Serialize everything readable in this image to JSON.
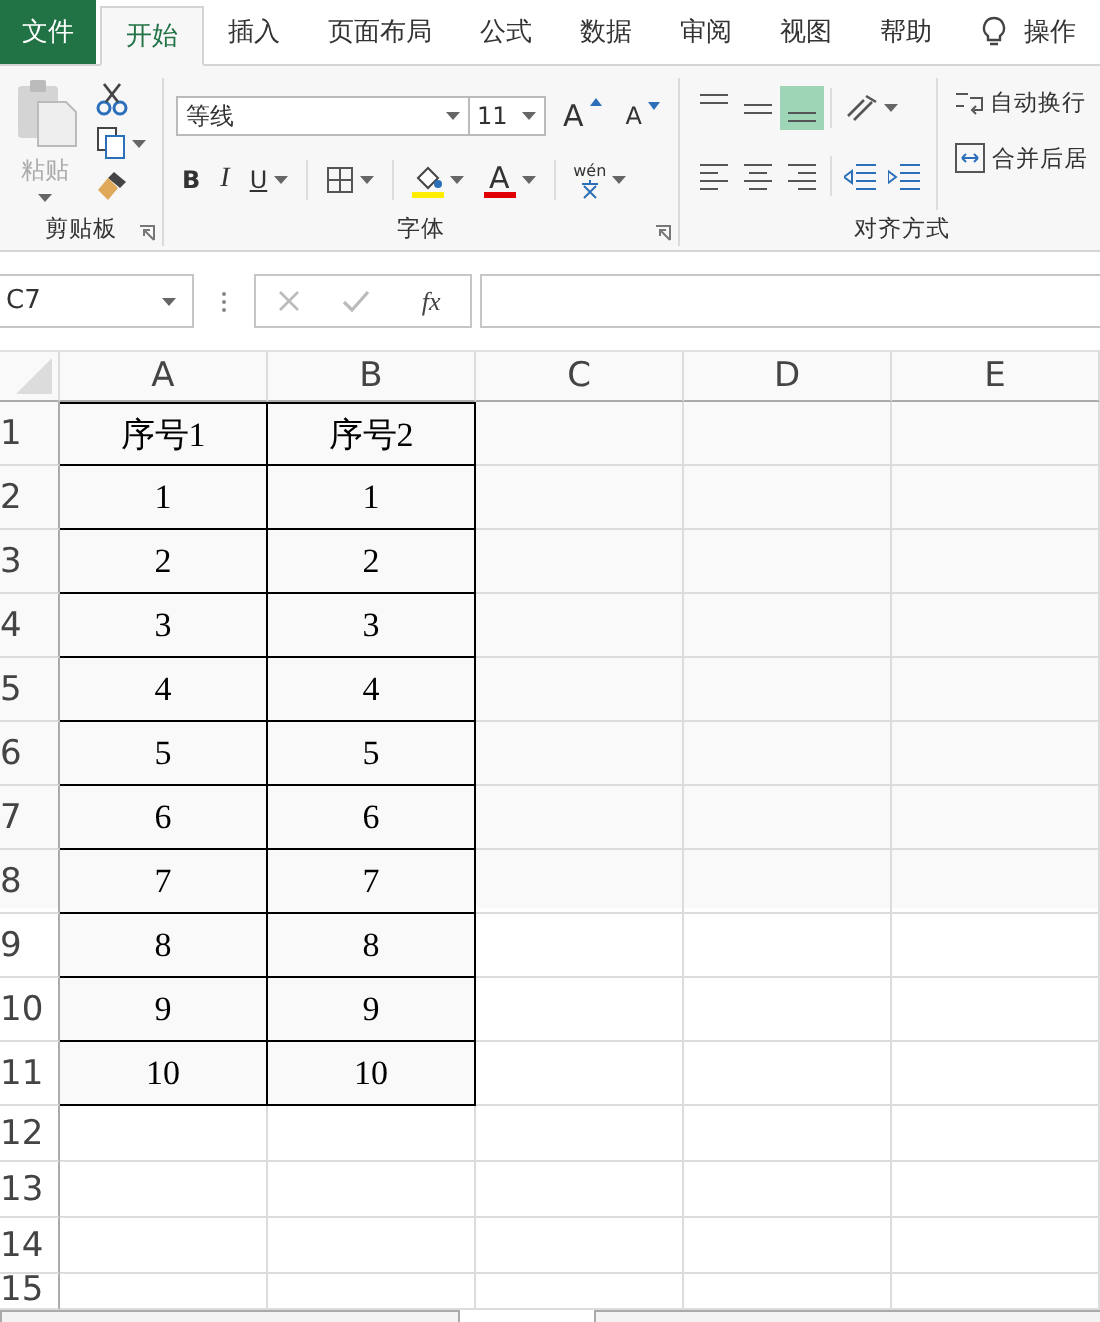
{
  "tabs": [
    {
      "label": "文件",
      "kind": "file",
      "selected": false
    },
    {
      "label": "开始",
      "kind": "tab",
      "selected": true
    },
    {
      "label": "插入",
      "kind": "tab",
      "selected": false
    },
    {
      "label": "页面布局",
      "kind": "tab",
      "selected": false
    },
    {
      "label": "公式",
      "kind": "tab",
      "selected": false
    },
    {
      "label": "数据",
      "kind": "tab",
      "selected": false
    },
    {
      "label": "审阅",
      "kind": "tab",
      "selected": false
    },
    {
      "label": "视图",
      "kind": "tab",
      "selected": false
    },
    {
      "label": "帮助",
      "kind": "tab",
      "selected": false
    }
  ],
  "tell_me": "操作",
  "ribbon": {
    "clipboard": {
      "paste_label": "粘贴",
      "group_label": "剪贴板"
    },
    "font": {
      "font_name": "等线",
      "font_size": "11",
      "grow_label": "A",
      "shrink_label": "A",
      "bold_label": "B",
      "italic_label": "I",
      "underline_label": "U",
      "font_color_label": "A",
      "phonetic_label": "wén",
      "group_label": "字体"
    },
    "alignment": {
      "vertical_align": [
        {
          "selected": false
        },
        {
          "selected": false
        },
        {
          "selected": true
        }
      ],
      "wrap_label": "自动换行",
      "merge_label": "合并后居",
      "group_label": "对齐方式"
    }
  },
  "formula_bar": {
    "name_box": "C7",
    "function_label": "fx"
  },
  "grid": {
    "columns": [
      "A",
      "B",
      "C",
      "D",
      "E"
    ],
    "rows": [
      {
        "header": "1",
        "cells": [
          "序号1",
          "序号2"
        ]
      },
      {
        "header": "2",
        "cells": [
          "1",
          "1"
        ]
      },
      {
        "header": "3",
        "cells": [
          "2",
          "2"
        ]
      },
      {
        "header": "4",
        "cells": [
          "3",
          "3"
        ]
      },
      {
        "header": "5",
        "cells": [
          "4",
          "4"
        ]
      },
      {
        "header": "6",
        "cells": [
          "5",
          "5"
        ]
      },
      {
        "header": "7",
        "cells": [
          "6",
          "6"
        ]
      },
      {
        "header": "8",
        "cells": [
          "7",
          "7"
        ]
      },
      {
        "header": "9",
        "cells": [
          "8",
          "8"
        ]
      },
      {
        "header": "10",
        "cells": [
          "9",
          "9"
        ]
      },
      {
        "header": "11",
        "cells": [
          "10",
          "10"
        ]
      },
      {
        "header": "12",
        "cells": []
      },
      {
        "header": "13",
        "cells": []
      },
      {
        "header": "14",
        "cells": []
      },
      {
        "header": "15",
        "cells": []
      }
    ]
  }
}
